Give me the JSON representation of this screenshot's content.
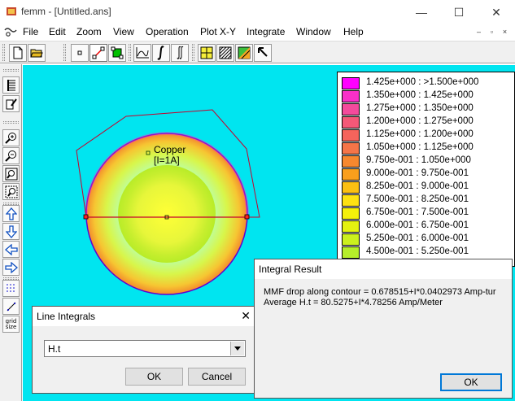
{
  "window": {
    "title": "femm - [Untitled.ans]",
    "minimize": "—",
    "maximize": "☐",
    "close": "✕"
  },
  "menu": [
    "File",
    "Edit",
    "Zoom",
    "View",
    "Operation",
    "Plot X-Y",
    "Integrate",
    "Window",
    "Help"
  ],
  "mdi_controls": [
    "–",
    "▫",
    "×"
  ],
  "toolbar_icons": [
    "new-file-icon",
    "open-folder-icon",
    "point-mode-icon",
    "contour-mode-icon",
    "area-mode-icon",
    "plot-xy-icon",
    "line-integral-icon",
    "area-integral-icon",
    "show-density-plot-icon",
    "show-contour-plot-icon",
    "show-vector-plot-icon",
    "select-arrow-icon"
  ],
  "vertical_toolbar_icons": [
    "show-results-icon",
    "edit-label-icon",
    "zoom-in-icon",
    "zoom-out-icon",
    "zoom-natural-icon",
    "zoom-window-icon",
    "pan-up-icon",
    "pan-down-icon",
    "pan-left-icon",
    "pan-right-icon",
    "show-grid-icon",
    "snap-grid-icon",
    "grid-size-icon"
  ],
  "grid_size_label": [
    "grid",
    "size"
  ],
  "canvas": {
    "block_label_name": "Copper",
    "block_label_current": "[I=1A]",
    "annotation_arrow_color": "#e8101a"
  },
  "legend": [
    {
      "color": "#ff00ff",
      "text": "1.425e+000 : >1.500e+000"
    },
    {
      "color": "#f830c8",
      "text": "1.350e+000 : 1.425e+000"
    },
    {
      "color": "#f44a9c",
      "text": "1.275e+000 : 1.350e+000"
    },
    {
      "color": "#f45878",
      "text": "1.200e+000 : 1.275e+000"
    },
    {
      "color": "#f5645c",
      "text": "1.125e+000 : 1.200e+000"
    },
    {
      "color": "#f57548",
      "text": "1.050e+000 : 1.125e+000"
    },
    {
      "color": "#f7882e",
      "text": "9.750e-001 : 1.050e+000"
    },
    {
      "color": "#fa9f1c",
      "text": "9.000e-001 : 9.750e-001"
    },
    {
      "color": "#fcc012",
      "text": "8.250e-001 : 9.000e-001"
    },
    {
      "color": "#fee212",
      "text": "7.500e-001 : 8.250e-001"
    },
    {
      "color": "#f5f00a",
      "text": "6.750e-001 : 7.500e-001"
    },
    {
      "color": "#e4f210",
      "text": "6.000e-001 : 6.750e-001"
    },
    {
      "color": "#ccf01e",
      "text": "5.250e-001 : 6.000e-001"
    },
    {
      "color": "#b6ee2a",
      "text": "4.500e-001 : 5.250e-001"
    }
  ],
  "line_integrals_dialog": {
    "title": "Line Integrals",
    "close": "✕",
    "selected": "H.t",
    "ok": "OK",
    "cancel": "Cancel"
  },
  "integral_result_dialog": {
    "title": "Integral Result",
    "line1": "MMF drop along contour = 0.678515+I*0.0402973 Amp-tur",
    "line2": "Average H.t = 80.5275+I*4.78256 Amp/Meter",
    "ok": "OK"
  }
}
